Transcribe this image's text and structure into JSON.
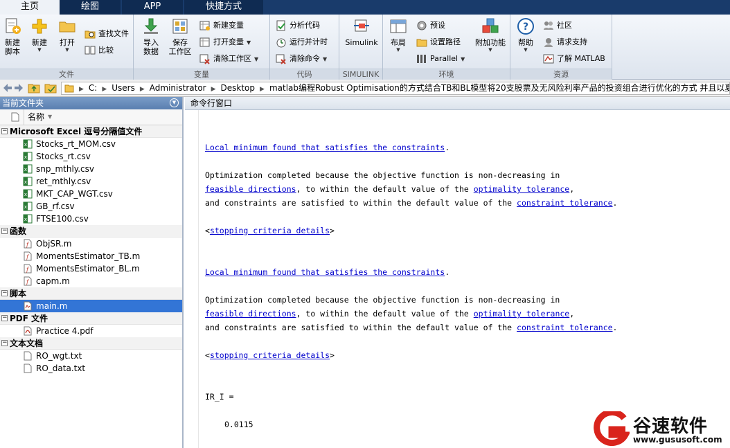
{
  "tabs": [
    {
      "label": "主页"
    },
    {
      "label": "绘图"
    },
    {
      "label": "APP"
    },
    {
      "label": "快捷方式"
    }
  ],
  "ribbon": {
    "file_group": {
      "label": "文件",
      "new_script": "新建\n脚本",
      "new": "新建",
      "open": "打开",
      "find_files": "查找文件",
      "compare": "比较"
    },
    "variable_group": {
      "label": "变量",
      "import_data": "导入\n数据",
      "save_workspace": "保存\n工作区",
      "new_variable": "新建变量",
      "open_variable": "打开变量",
      "clear_workspace": "清除工作区"
    },
    "code_group": {
      "label": "代码",
      "analyze_code": "分析代码",
      "run_and_time": "运行并计时",
      "clear_commands": "清除命令"
    },
    "simulink_group": {
      "label": "SIMULINK",
      "simulink": "Simulink"
    },
    "env_group": {
      "label": "环境",
      "layout": "布局",
      "preferences": "预设",
      "set_path": "设置路径",
      "parallel": "Parallel",
      "addons": "附加功能"
    },
    "resources_group": {
      "label": "资源",
      "help": "帮助",
      "community": "社区",
      "request_support": "请求支持",
      "learn_matlab": "了解 MATLAB"
    }
  },
  "address": {
    "crumbs": [
      "C:",
      "Users",
      "Administrator",
      "Desktop",
      "matlab编程Robust Optimisation的方式结合TB和BL模型将20支股票及无风险利率产品的投资组合进行优化的方式 并且以夏普"
    ]
  },
  "left_panel": {
    "title": "当前文件夹",
    "column_name": "名称",
    "categories": [
      {
        "label": "Microsoft Excel 逗号分隔值文件",
        "files": [
          "Stocks_rt_MOM.csv",
          "Stocks_rt.csv",
          "snp_mthly.csv",
          "ret_mthly.csv",
          "MKT_CAP_WGT.csv",
          "GB_rf.csv",
          "FTSE100.csv"
        ]
      },
      {
        "label": "函数",
        "files": [
          "ObjSR.m",
          "MomentsEstimator_TB.m",
          "MomentsEstimator_BL.m",
          "capm.m"
        ]
      },
      {
        "label": "脚本",
        "files": [
          "main.m"
        ]
      },
      {
        "label": "PDF 文件",
        "files": [
          "Practice 4.pdf"
        ]
      },
      {
        "label": "文本文档",
        "files": [
          "RO_wgt.txt",
          "RO_data.txt"
        ]
      }
    ],
    "selected_file": "main.m"
  },
  "command_window": {
    "title": "命令行窗口",
    "blocks": [
      {
        "headline": "Local minimum found that satisfies the constraints",
        "line1": "Optimization completed because the objective function is non-decreasing in",
        "link_feasible": "feasible directions",
        "mid2": ", to within the default value of the ",
        "link_optimality": "optimality tolerance",
        "line3_prefix": "and constraints are satisfied to within the default value of the ",
        "link_constraint": "constraint tolerance",
        "link_stopping": "stopping criteria details"
      },
      {
        "headline": "Local minimum found that satisfies the constraints",
        "line1": "Optimization completed because the objective function is non-decreasing in",
        "link_feasible": "feasible directions",
        "mid2": ", to within the default value of the ",
        "link_optimality": "optimality tolerance",
        "line3_prefix": "and constraints are satisfied to within the default value of the ",
        "link_constraint": "constraint tolerance",
        "link_stopping": "stopping criteria details"
      }
    ],
    "result_var": "IR_I =",
    "result_value": "0.0115"
  },
  "watermark": {
    "name": "谷速软件",
    "url": "www.gususoft.com"
  }
}
